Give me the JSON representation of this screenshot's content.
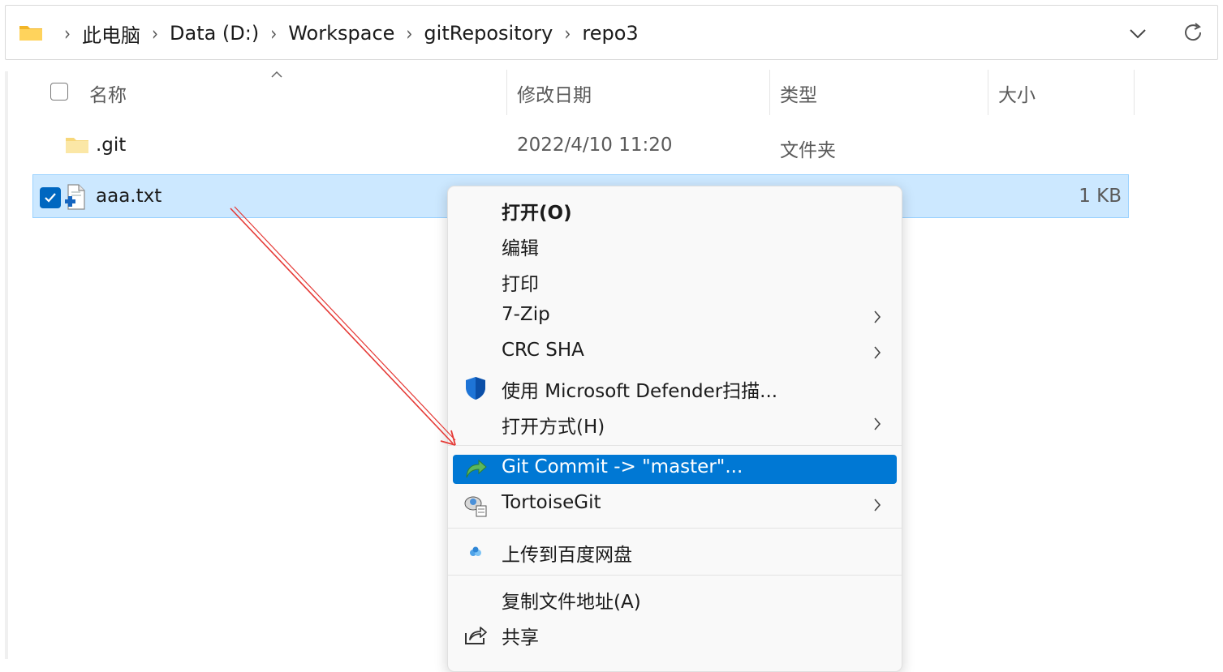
{
  "breadcrumb": {
    "items": [
      "此电脑",
      "Data (D:)",
      "Workspace",
      "gitRepository",
      "repo3"
    ]
  },
  "columns": {
    "name": "名称",
    "modified": "修改日期",
    "type": "类型",
    "size": "大小"
  },
  "files": [
    {
      "name": ".git",
      "modified": "2022/4/10 11:20",
      "type": "文件夹",
      "size": ""
    },
    {
      "name": "aaa.txt",
      "modified": "",
      "type": "",
      "size": "1 KB",
      "selected": true
    }
  ],
  "context_menu": {
    "items": [
      {
        "label": "打开(O)",
        "bold": true
      },
      {
        "label": "编辑"
      },
      {
        "label": "打印"
      },
      {
        "label": "7-Zip",
        "submenu": true
      },
      {
        "label": "CRC SHA",
        "submenu": true
      },
      {
        "label": "使用 Microsoft Defender扫描...",
        "icon": "defender-shield-icon"
      },
      {
        "label": "打开方式(H)",
        "submenu": true
      },
      {
        "label": "Git Commit -> \"master\"...",
        "icon": "git-commit-icon",
        "highlighted": true
      },
      {
        "label": "TortoiseGit",
        "icon": "tortoisegit-icon",
        "submenu": true
      },
      {
        "label": "上传到百度网盘",
        "icon": "baidu-netdisk-icon"
      },
      {
        "label": "复制文件地址(A)"
      },
      {
        "label": "共享",
        "icon": "share-icon"
      }
    ]
  },
  "colors": {
    "selection": "#cce8ff",
    "menu_highlight": "#0078d4",
    "annotation_arrow": "#e53935",
    "folder": "#f5c242"
  }
}
